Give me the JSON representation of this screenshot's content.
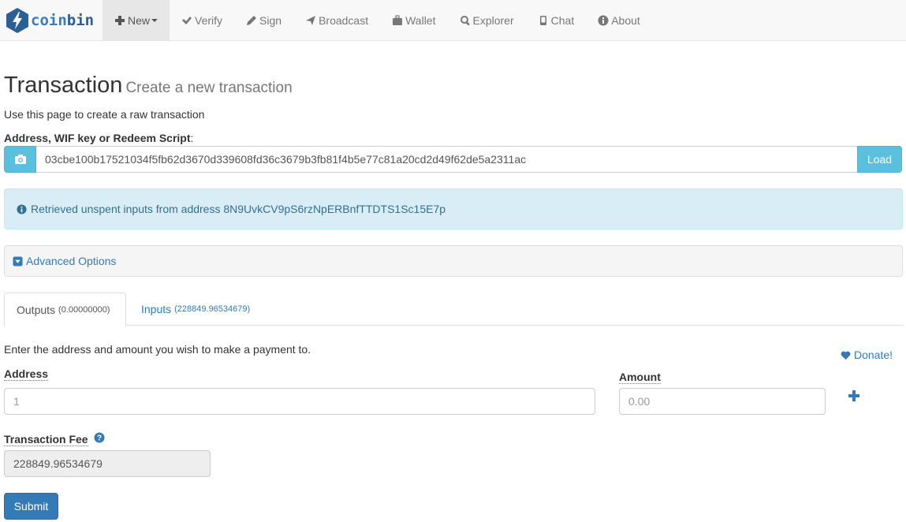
{
  "brand": {
    "part1": "coin",
    "part2": "bin"
  },
  "nav": [
    {
      "label": "New",
      "icon": "plus-icon",
      "active": true,
      "dropdown": true
    },
    {
      "label": "Verify",
      "icon": "check-icon"
    },
    {
      "label": "Sign",
      "icon": "pencil-icon"
    },
    {
      "label": "Broadcast",
      "icon": "send-icon"
    },
    {
      "label": "Wallet",
      "icon": "briefcase-icon"
    },
    {
      "label": "Explorer",
      "icon": "search-icon"
    },
    {
      "label": "Chat",
      "icon": "phone-icon"
    },
    {
      "label": "About",
      "icon": "info-icon"
    }
  ],
  "page": {
    "title": "Transaction",
    "subtitle": "Create a new transaction",
    "lead": "Use this page to create a raw transaction"
  },
  "address_input": {
    "label": "Address, WIF key or Redeem Script",
    "colon": ":",
    "value": "03cbe100b17521034f5fb62d3670d339608fd36c3679b3fb81f4b5e77c81a20cd2d49f62de5a2311ac",
    "load_label": "Load"
  },
  "alert": {
    "text": "Retrieved unspent inputs from address 8N9UvkCV9pS6rzNpERBnfTTDTS1Sc15E7p"
  },
  "advanced": {
    "label": "Advanced Options"
  },
  "tabs": {
    "outputs_label": "Outputs",
    "outputs_count": "(0.00000000)",
    "inputs_label": "Inputs",
    "inputs_count": "(228849.96534679)"
  },
  "outputs": {
    "intro": "Enter the address and amount you wish to make a payment to.",
    "donate_label": "Donate!",
    "address_label": "Address",
    "address_placeholder": "1",
    "amount_label": "Amount",
    "amount_placeholder": "0.00"
  },
  "fee": {
    "label": "Transaction Fee",
    "value": "228849.96534679"
  },
  "submit_label": "Submit",
  "colors": {
    "info": "#5bc0de",
    "primary": "#337ab7",
    "alert_bg": "#d9edf7",
    "alert_text": "#31708f"
  }
}
